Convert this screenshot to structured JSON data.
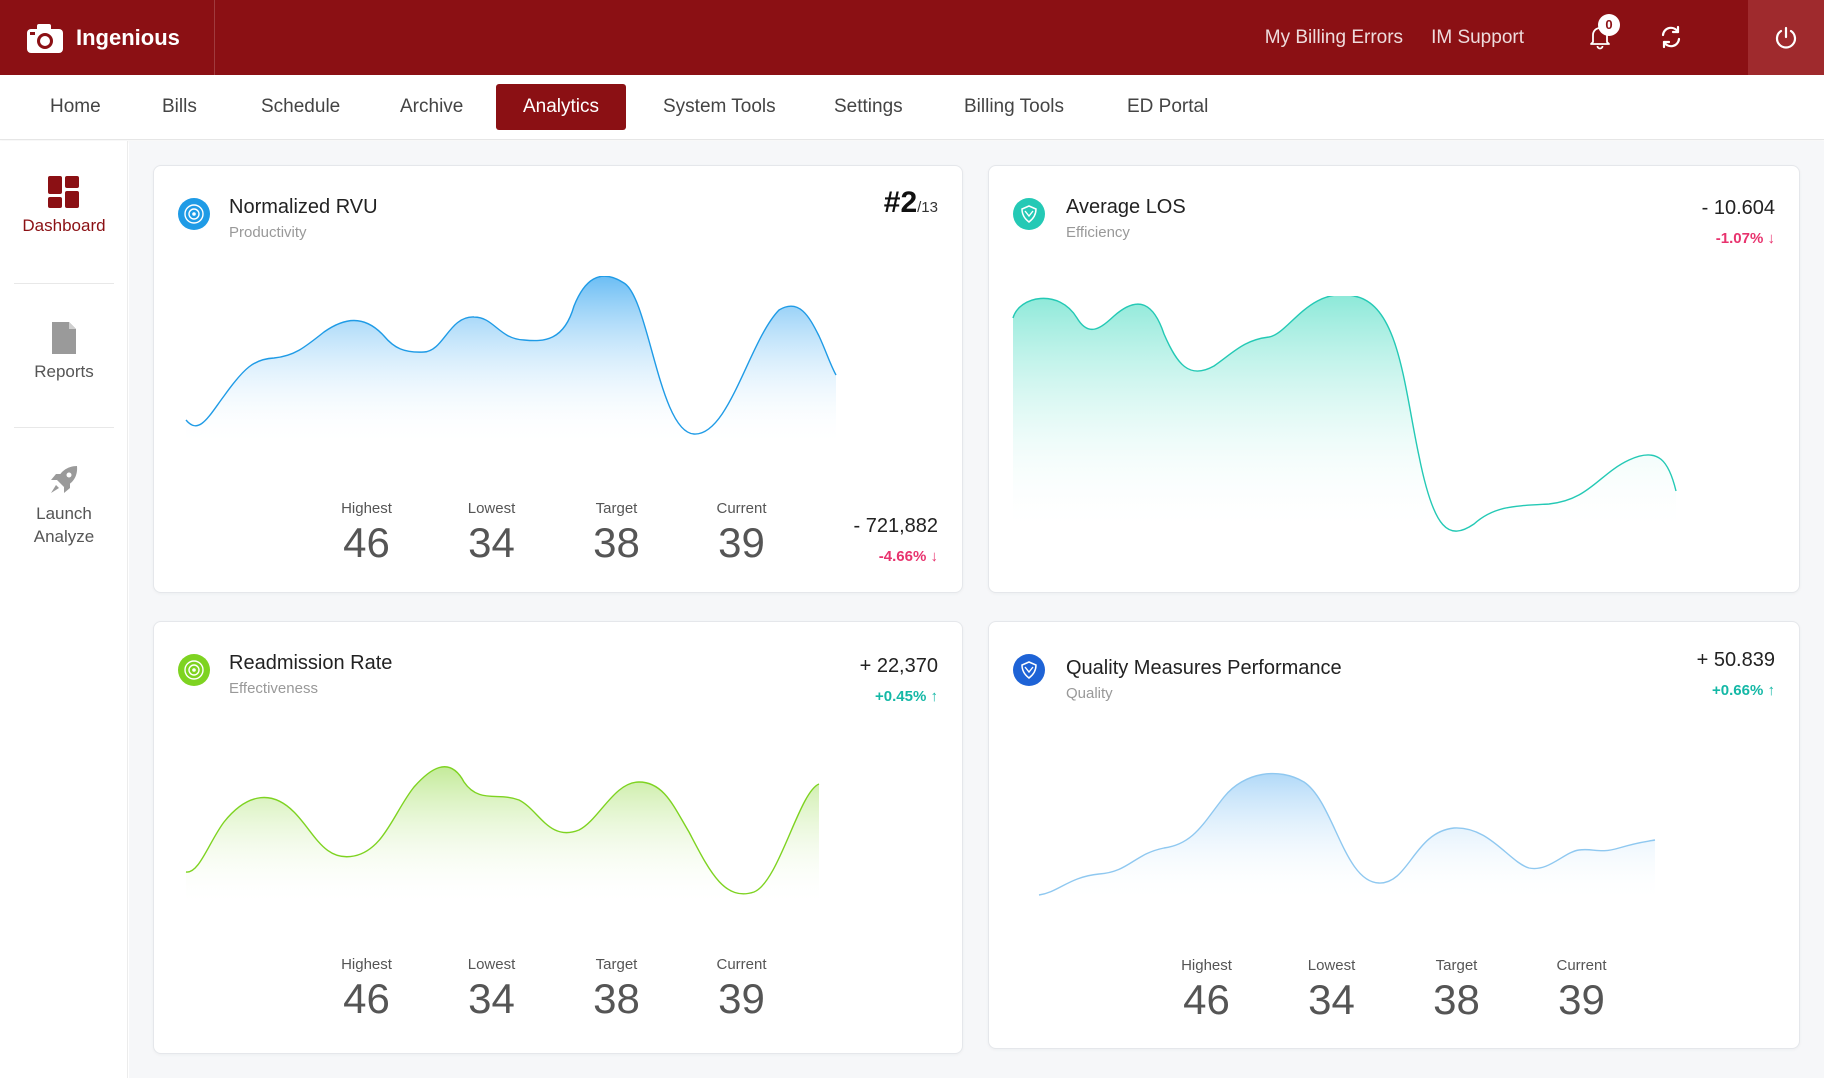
{
  "app": {
    "name": "Ingenious"
  },
  "header": {
    "links": [
      "My Billing Errors",
      "IM Support"
    ],
    "notification_count": "0"
  },
  "nav": {
    "tabs": [
      "Home",
      "Bills",
      "Schedule",
      "Archive",
      "Analytics",
      "System Tools",
      "Settings",
      "Billing Tools",
      "ED Portal"
    ],
    "active": "Analytics"
  },
  "sidebar": {
    "items": [
      {
        "label": "Dashboard",
        "icon": "dashboard-icon"
      },
      {
        "label": "Reports",
        "icon": "document-icon"
      },
      {
        "label": "Launch Analyze",
        "icon": "rocket-icon"
      }
    ]
  },
  "stat_labels": {
    "highest": "Highest",
    "lowest": "Lowest",
    "target": "Target",
    "current": "Current"
  },
  "cards": {
    "rvu": {
      "title": "Normalized RVU",
      "subtitle": "Productivity",
      "rank": "#2",
      "rank_total": "/13",
      "value": "- 721,882",
      "change": "-4.66%",
      "highest": "46",
      "lowest": "34",
      "target": "38",
      "current": "39",
      "color": "#1f9be6"
    },
    "los": {
      "title": "Average LOS",
      "subtitle": "Efficiency",
      "value": "- 10.604",
      "change": "-1.07%",
      "color": "#24c9b5"
    },
    "readmission": {
      "title": "Readmission Rate",
      "subtitle": "Effectiveness",
      "value": "+ 22,370",
      "change": "+0.45%",
      "highest": "46",
      "lowest": "34",
      "target": "38",
      "current": "39",
      "color": "#7ed321"
    },
    "quality": {
      "title": "Quality Measures Performance",
      "subtitle": "Quality",
      "value": "+ 50.839",
      "change": "+0.66%",
      "highest": "46",
      "lowest": "34",
      "target": "38",
      "current": "39",
      "color": "#1e63d6"
    }
  },
  "colors": {
    "brand": "#8b1014",
    "negative": "#e8336e",
    "positive": "#14b8a6"
  }
}
